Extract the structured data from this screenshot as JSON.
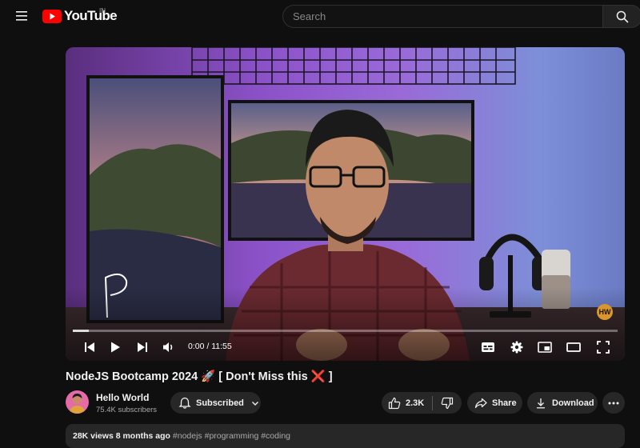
{
  "header": {
    "logo_text": "YouTube",
    "country_code": "IN",
    "search_placeholder": "Search",
    "icons": [
      "menu-icon",
      "youtube-logo-icon",
      "search-icon"
    ]
  },
  "player": {
    "current_time": "0:00",
    "duration": "11:55",
    "time_display": "0:00 / 11:55",
    "progress": 0.03,
    "watermark": "HW",
    "controls": [
      "previous-icon",
      "play-icon",
      "next-icon",
      "volume-icon",
      "subtitles-icon",
      "settings-icon",
      "miniplayer-icon",
      "theater-mode-icon",
      "fullscreen-icon"
    ]
  },
  "video": {
    "title": "NodeJS Bootcamp 2024 🚀 [ Don't Miss this ❌ ]"
  },
  "channel": {
    "name": "Hello World",
    "subscribers": "75.4K subscribers",
    "subscribe_label": "Subscribed"
  },
  "actions": {
    "like_count": "2.3K",
    "share_label": "Share",
    "download_label": "Download"
  },
  "description": {
    "views": "28K views",
    "age": "8 months ago",
    "tags": "#nodejs #programming #coding"
  },
  "colors": {
    "background": "#0f0f0f",
    "pill": "#272727",
    "brand_red": "#ff0000",
    "watermark": "#d9962c"
  }
}
